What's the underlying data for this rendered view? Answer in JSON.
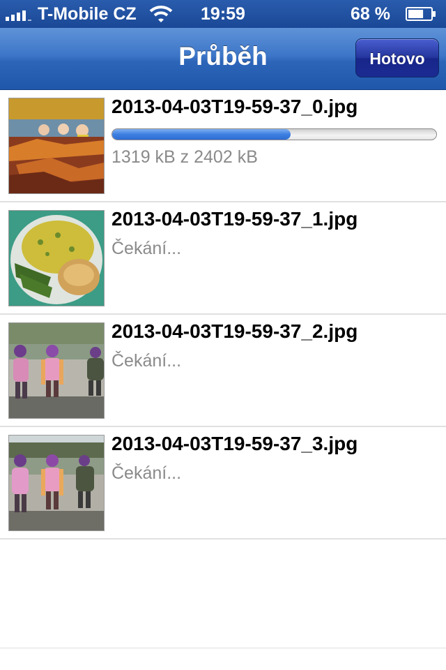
{
  "status_bar": {
    "carrier": "T-Mobile CZ",
    "time": "19:59",
    "battery_percent": "68 %",
    "battery_level": 0.68,
    "signal_bars": 4
  },
  "nav": {
    "title": "Průběh",
    "done_label": "Hotovo"
  },
  "uploads": [
    {
      "filename": "2013-04-03T19-59-37_0.jpg",
      "status": "1319 kB z 2402 kB",
      "progress": 0.55,
      "thumbnail": "photo-children-on-sofa"
    },
    {
      "filename": "2013-04-03T19-59-37_1.jpg",
      "status": "Čekání...",
      "thumbnail": "photo-plate-of-food"
    },
    {
      "filename": "2013-04-03T19-59-37_2.jpg",
      "status": "Čekání...",
      "thumbnail": "photo-children-outdoors"
    },
    {
      "filename": "2013-04-03T19-59-37_3.jpg",
      "status": "Čekání...",
      "thumbnail": "photo-children-outdoors"
    }
  ],
  "colors": {
    "nav_blue": "#3d76c8",
    "progress_blue": "#3d7fe1",
    "status_gray": "#8a8a8a"
  }
}
